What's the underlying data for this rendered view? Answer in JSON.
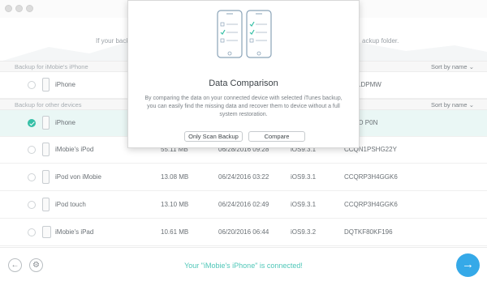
{
  "hero": {
    "text_left": "If your back",
    "text_right": "ackup folder."
  },
  "sections": {
    "current": {
      "title": "Backup for iMobie's iPhone",
      "sort": "Sort by name"
    },
    "others": {
      "title": "Backup for other devices",
      "sort": "Sort by name"
    }
  },
  "current_backups": [
    {
      "name": "iPhone",
      "serial": "2CC1DPMW"
    }
  ],
  "other_backups": [
    {
      "name": "iPhone",
      "serial": "30L4D P0N",
      "selected": true
    },
    {
      "name": "iMobie's iPod",
      "size": "55.11 MB",
      "date": "06/28/2016 09:28",
      "ios": "iOS9.3.1",
      "serial": "CCQN1PSHG22Y"
    },
    {
      "name": "iPod von iMobie",
      "size": "13.08 MB",
      "date": "06/24/2016 03:22",
      "ios": "iOS9.3.1",
      "serial": "CCQRP3H4GGK6"
    },
    {
      "name": "iPod touch",
      "size": "13.10 MB",
      "date": "06/24/2016 02:49",
      "ios": "iOS9.3.1",
      "serial": "CCQRP3H4GGK6"
    },
    {
      "name": "iMobie's iPad",
      "size": "10.61 MB",
      "date": "06/20/2016 06:44",
      "ios": "iOS9.3.2",
      "serial": "DQTKF80KF196"
    }
  ],
  "dialog": {
    "title": "Data Comparison",
    "description": "By comparing the data on your connected device with selected iTunes backup, you can easily find the missing data and recover them to device without a full system restoration.",
    "btn_scan": "Only Scan Backup",
    "btn_compare": "Compare"
  },
  "footer": {
    "status": "Your \"iMobie's iPhone\" is connected!"
  },
  "colors": {
    "accent": "#35bfa6",
    "next_button": "#35a9e8",
    "status_text": "#4fc7b8"
  },
  "icons": {
    "back": "arrow-left-icon",
    "settings": "gear-icon",
    "next": "arrow-right-icon"
  }
}
